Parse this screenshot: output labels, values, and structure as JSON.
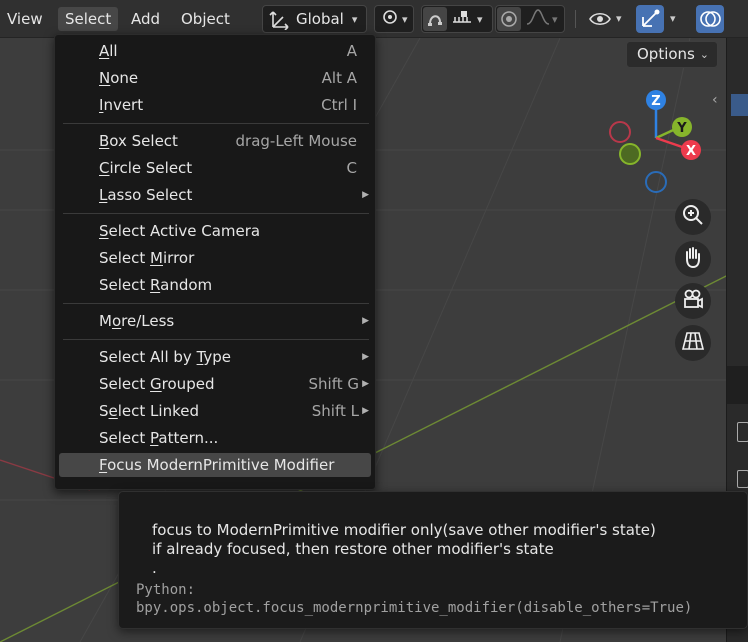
{
  "header": {
    "menus": [
      {
        "label": "View"
      },
      {
        "label": "Select"
      },
      {
        "label": "Add"
      },
      {
        "label": "Object"
      }
    ],
    "orientation": {
      "label": "Global"
    }
  },
  "overlay": {
    "options_label": "Options"
  },
  "gizmo": {
    "z": "Z",
    "y": "Y",
    "x": "X"
  },
  "menu": {
    "items": [
      {
        "pre": "",
        "key": "A",
        "post": "ll",
        "shortcut": "A"
      },
      {
        "pre": "",
        "key": "N",
        "post": "one",
        "shortcut": "Alt A"
      },
      {
        "pre": "",
        "key": "I",
        "post": "nvert",
        "shortcut": "Ctrl I"
      },
      {
        "pre": "",
        "key": "B",
        "post": "ox Select",
        "shortcut": "drag-Left Mouse"
      },
      {
        "pre": "",
        "key": "C",
        "post": "ircle Select",
        "shortcut": "C"
      },
      {
        "pre": "",
        "key": "L",
        "post": "asso Select",
        "shortcut": ""
      },
      {
        "pre": "",
        "key": "S",
        "post": "elect Active Camera",
        "shortcut": ""
      },
      {
        "pre": "Select ",
        "key": "M",
        "post": "irror",
        "shortcut": ""
      },
      {
        "pre": "Select ",
        "key": "R",
        "post": "andom",
        "shortcut": ""
      },
      {
        "pre": "M",
        "key": "o",
        "post": "re/Less",
        "shortcut": ""
      },
      {
        "pre": "Select All by ",
        "key": "T",
        "post": "ype",
        "shortcut": ""
      },
      {
        "pre": "Select ",
        "key": "G",
        "post": "rouped",
        "shortcut": "Shift G"
      },
      {
        "pre": "S",
        "key": "e",
        "post": "lect Linked",
        "shortcut": "Shift L"
      },
      {
        "pre": "Select ",
        "key": "P",
        "post": "attern...",
        "shortcut": ""
      },
      {
        "pre": "",
        "key": "F",
        "post": "ocus ModernPrimitive Modifier",
        "shortcut": ""
      }
    ]
  },
  "tooltip": {
    "line1": "focus to ModernPrimitive modifier only(save other modifier's state)",
    "line2": "if already focused, then restore other modifier's state",
    "line3": ".",
    "python_label": "Python:",
    "python_call": "bpy.ops.object.focus_modernprimitive_modifier(disable_others=True)"
  },
  "colors": {
    "axis_x": "#ed3b4d",
    "axis_y": "#86b52b",
    "axis_z": "#2f82e3",
    "menu_bg": "#181818",
    "highlight": "#474747",
    "viewport_bg": "#3d3d3d"
  },
  "icons": [
    "transform-pivot-icon",
    "snap-icon",
    "increment-icon",
    "proportional-edit-icon",
    "falloff-icon",
    "visibility-icon",
    "gizmo-icon",
    "overlay-icon",
    "zoom-icon",
    "hand-pan-icon",
    "camera-icon",
    "perspective-grid-icon"
  ]
}
